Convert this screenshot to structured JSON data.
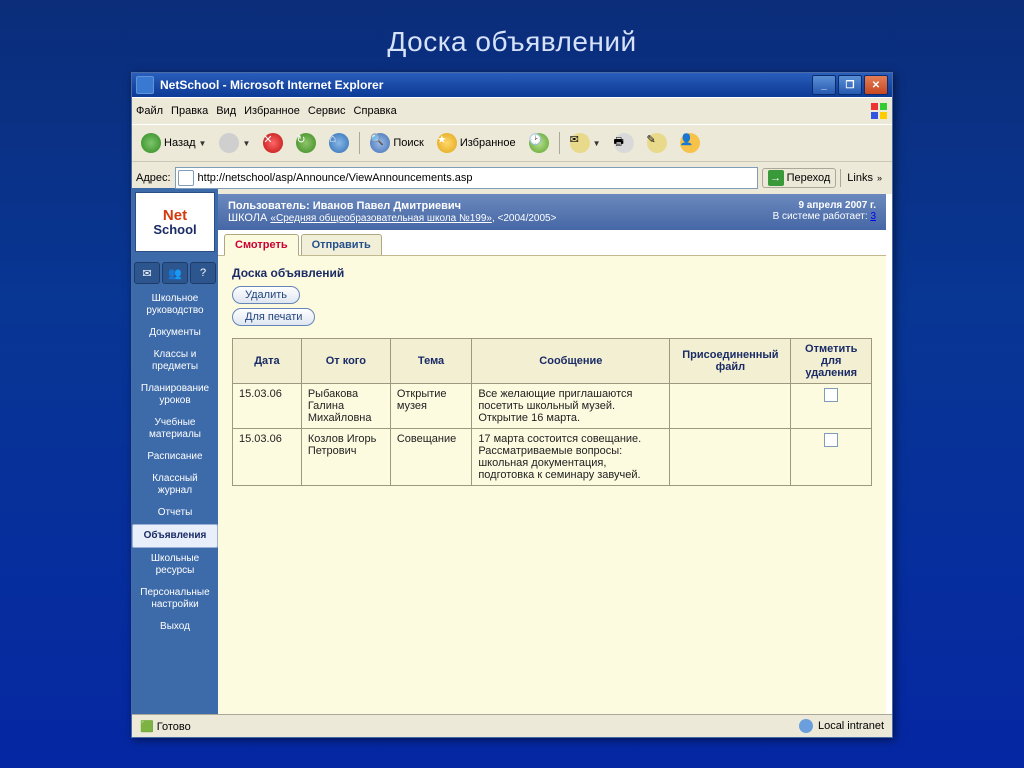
{
  "slide_title": "Доска объявлений",
  "window": {
    "title": "NetSchool - Microsoft Internet Explorer"
  },
  "menubar": {
    "items": [
      "Файл",
      "Правка",
      "Вид",
      "Избранное",
      "Сервис",
      "Справка"
    ]
  },
  "toolbar": {
    "back": "Назад",
    "search": "Поиск",
    "favorites": "Избранное"
  },
  "addressbar": {
    "label": "Адрес:",
    "url": "http://netschool/asp/Announce/ViewAnnouncements.asp",
    "go": "Переход",
    "links": "Links"
  },
  "appheader": {
    "user_label": "Пользователь: Иванов Павел Дмитриевич",
    "school_prefix": "ШКОЛА ",
    "school_link": "«Средняя общеобразовательная школа №199»",
    "period": ", <2004/2005>",
    "date": "9 апреля 2007 г.",
    "sys_label": "В системе работает: ",
    "sys_count": "3"
  },
  "logo": {
    "line1": "Net",
    "line2": "School"
  },
  "sidebar": {
    "items": [
      "Школьное руководство",
      "Документы",
      "Классы и предметы",
      "Планирование уроков",
      "Учебные материалы",
      "Расписание",
      "Классный журнал",
      "Отчеты",
      "Объявления",
      "Школьные ресурсы",
      "Персональные настройки",
      "Выход"
    ]
  },
  "tabs": {
    "view": "Смотреть",
    "send": "Отправить"
  },
  "page": {
    "title": "Доска объявлений",
    "delete": "Удалить",
    "print": "Для печати"
  },
  "table": {
    "cols": [
      "Дата",
      "От кого",
      "Тема",
      "Сообщение",
      "Присоединенный файл",
      "Отметить для удаления"
    ],
    "rows": [
      {
        "date": "15.03.06",
        "from": "Рыбакова Галина Михайловна",
        "subject": "Открытие музея",
        "message": "Все желающие приглашаются посетить школьный музей. Открытие 16 марта.",
        "file": ""
      },
      {
        "date": "15.03.06",
        "from": "Козлов Игорь Петрович",
        "subject": "Совещание",
        "message": "17 марта состоится совещание. Рассматриваемые вопросы: школьная документация, подготовка к семинару завучей.",
        "file": ""
      }
    ]
  },
  "status": {
    "ready": "Готово",
    "zone": "Local intranet"
  }
}
